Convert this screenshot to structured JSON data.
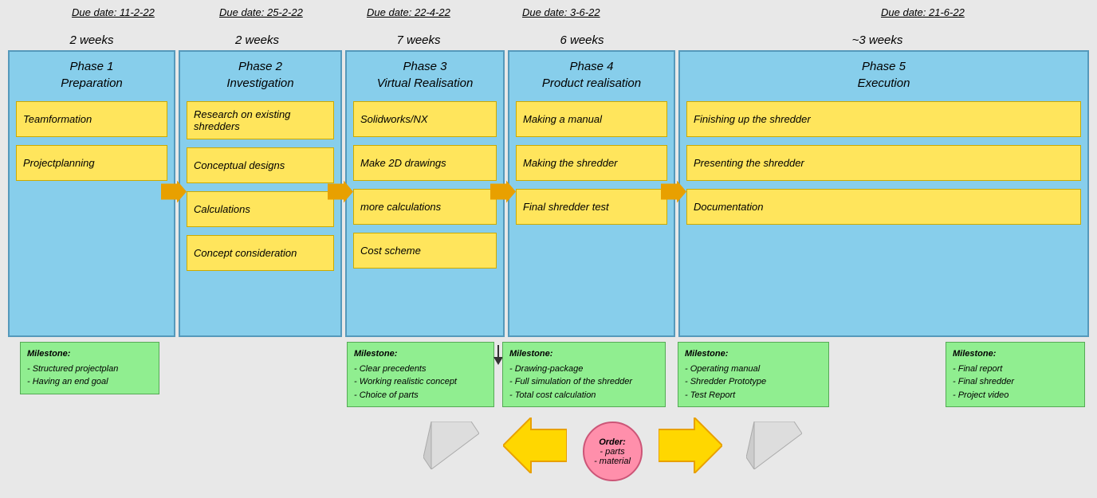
{
  "dueDates": [
    {
      "label": "Due date: 11-2-22"
    },
    {
      "label": "Due date: 25-2-22"
    },
    {
      "label": "Due date: 22-4-22"
    },
    {
      "label": "Due date: 3-6-22"
    },
    {
      "label": "Due date: 21-6-22"
    }
  ],
  "weeks": [
    {
      "label": "2 weeks"
    },
    {
      "label": "2 weeks"
    },
    {
      "label": "7 weeks"
    },
    {
      "label": "6 weeks"
    },
    {
      "label": "~3 weeks"
    }
  ],
  "phases": [
    {
      "title": "Phase 1\nPreparation",
      "tasks": [
        "Teamformation",
        "Projectplanning"
      ]
    },
    {
      "title": "Phase 2\nInvestigation",
      "tasks": [
        "Research on existing shredders",
        "Conceptual designs",
        "Calculations",
        "Concept consideration"
      ]
    },
    {
      "title": "Phase 3\nVirtual Realisation",
      "tasks": [
        "Solidworks/NX",
        "Make 2D drawings",
        "more calculations",
        "Cost scheme"
      ]
    },
    {
      "title": "Phase 4\nProduct realisation",
      "tasks": [
        "Making a manual",
        "Making the shredder",
        "Final shredder test"
      ]
    },
    {
      "title": "Phase 5\nExecution",
      "tasks": [
        "Finishing up the shredder",
        "Presenting the shredder",
        "Documentation"
      ]
    }
  ],
  "milestones": [
    {
      "title": "Milestone:",
      "items": [
        "- Structured projectplan",
        "- Having an end goal"
      ]
    },
    {
      "title": "Milestone:",
      "items": [
        "- Clear precedents",
        "- Working realistic concept",
        "- Choice of parts"
      ]
    },
    {
      "title": "Milestone:",
      "items": [
        "- Drawing-package",
        "- Full simulation of the shredder",
        "- Total cost calculation"
      ]
    },
    {
      "title": "Milestone:",
      "items": [
        "- Operating manual",
        "- Shredder Prototype",
        "- Test Report"
      ]
    },
    {
      "title": "Milestone:",
      "items": [
        "- Final report",
        "- Final shredder",
        "- Project video"
      ]
    }
  ],
  "order": {
    "title": "Order:",
    "items": [
      "- parts",
      "- material"
    ]
  }
}
